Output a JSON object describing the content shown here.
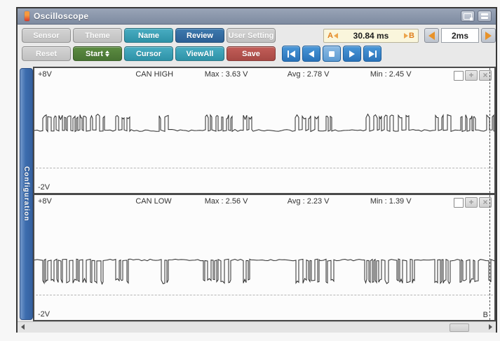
{
  "window": {
    "title": "Oscilloscope"
  },
  "titlebar": {
    "buttons": [
      {
        "name": "pop-out-button",
        "icon": "pop-out-icon"
      },
      {
        "name": "layout-button",
        "icon": "split-layout-icon"
      }
    ]
  },
  "toolbar": {
    "row1": [
      {
        "label": "Sensor",
        "variant": "gray"
      },
      {
        "label": "Theme",
        "variant": "gray"
      },
      {
        "label": "Name",
        "variant": "teal"
      },
      {
        "label": "Review",
        "variant": "blue"
      },
      {
        "label": "User Setting",
        "variant": "gray"
      }
    ],
    "row2": [
      {
        "label": "Reset",
        "variant": "gray"
      },
      {
        "label": "Start",
        "variant": "green",
        "spinner": true
      },
      {
        "label": "Cursor",
        "variant": "teal"
      },
      {
        "label": "ViewAll",
        "variant": "teal"
      },
      {
        "label": "Save",
        "variant": "red"
      }
    ],
    "playback": [
      "skip-to-start",
      "step-back",
      "stop",
      "play",
      "skip-to-end"
    ],
    "ab_readout": {
      "a_label": "A",
      "value": "30.84 ms",
      "b_label": "B"
    },
    "timebase": {
      "value": "2ms",
      "left_icon": "left-arrow-icon",
      "right_icon": "right-arrow-icon"
    }
  },
  "sidebar": {
    "label": "Configuration"
  },
  "channels": [
    {
      "top_voltage": "+8V",
      "name": "CAN HIGH",
      "max": "Max : 3.63 V",
      "avg": "Avg : 2.78 V",
      "min": "Min : 2.45 V",
      "bottom_voltage": "-2V"
    },
    {
      "top_voltage": "+8V",
      "name": "CAN LOW",
      "max": "Max : 2.56 V",
      "avg": "Avg : 2.23 V",
      "min": "Min : 1.39 V",
      "bottom_voltage": "-2V",
      "cursor_label": "B"
    }
  ],
  "waveforms": {
    "bursts": [
      [
        0.017,
        0.153
      ],
      [
        0.176,
        0.207
      ],
      [
        0.271,
        0.298
      ],
      [
        0.366,
        0.433
      ],
      [
        0.45,
        0.471
      ],
      [
        0.567,
        0.616
      ],
      [
        0.631,
        0.653
      ],
      [
        0.716,
        0.774
      ],
      [
        0.787,
        0.822
      ],
      [
        0.866,
        0.906
      ],
      [
        0.924,
        0.962
      ],
      [
        0.983,
        1.0
      ]
    ],
    "ch1": {
      "baseline_frac": 0.5,
      "active_frac": 0.39,
      "seed": 7
    },
    "ch2": {
      "baseline_frac": 0.52,
      "active_frac": 0.69,
      "seed": 13
    }
  },
  "colors": {
    "titlebar": "#7e8ba1",
    "button_teal": "#2e92a7",
    "button_blue": "#2c6095",
    "button_green": "#487433",
    "button_red": "#a74945",
    "playback_blue": "#2a73b9",
    "ab_background": "#faf6dc",
    "ab_accent": "#e07f1e",
    "config_tab": "#3c6cae",
    "waveform": "#2b2b2b"
  },
  "scrollbar": {
    "left_icon": "left-arrow-icon",
    "right_icon": "right-arrow-icon"
  }
}
